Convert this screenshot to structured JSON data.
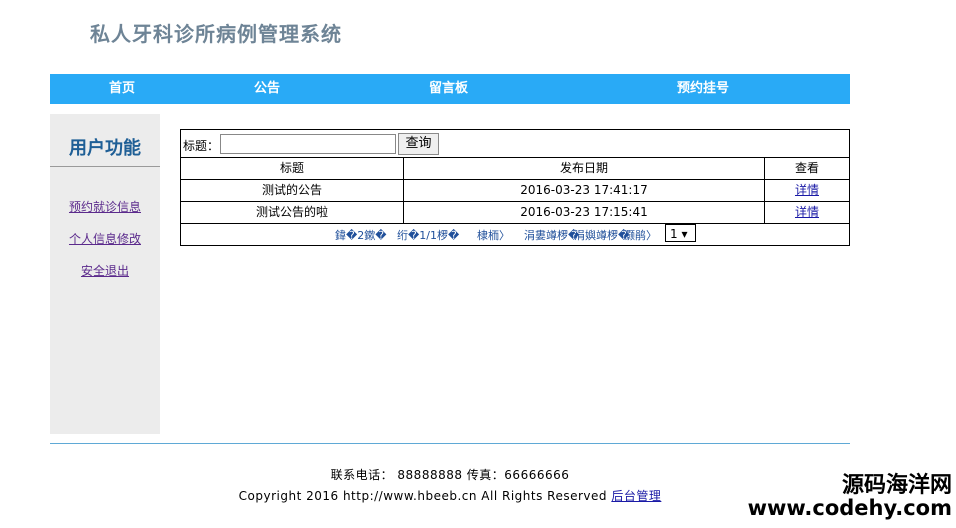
{
  "header": {
    "title": "私人牙科诊所病例管理系统"
  },
  "nav": {
    "home": "首页",
    "notice": "公告",
    "message_board": "留言板",
    "appointment": "预约挂号"
  },
  "sidebar": {
    "title": "用户功能",
    "items": [
      {
        "label": "预约就诊信息"
      },
      {
        "label": "个人信息修改"
      },
      {
        "label": "安全退出"
      }
    ]
  },
  "search": {
    "label": "标题：",
    "value": "",
    "placeholder": "",
    "button": "查询"
  },
  "table": {
    "headers": [
      "标题",
      "发布日期",
      "查看"
    ],
    "rows": [
      {
        "title": "测试的公告",
        "date": "2016-03-23 17:41:17",
        "action": "详情"
      },
      {
        "title": "测试公告的啦",
        "date": "2016-03-23 17:15:41",
        "action": "详情"
      }
    ]
  },
  "pager": {
    "items": [
      "鍏�2鏉�",
      "绗�1/1椤�",
      "棣栭〉",
      "涓婁竴椤�",
      "涓嬩竴椤�",
      "灏鹃〉"
    ],
    "selected_page": "1 ▾"
  },
  "footer": {
    "contact": "联系电话： 88888888 传真：66666666",
    "copyright": "Copyright 2016 http://www.hbeeb.cn All Rights Reserved",
    "admin_link": "后台管理"
  },
  "watermark": {
    "line1": "源码海洋网",
    "line2": "www.codehy.com"
  }
}
